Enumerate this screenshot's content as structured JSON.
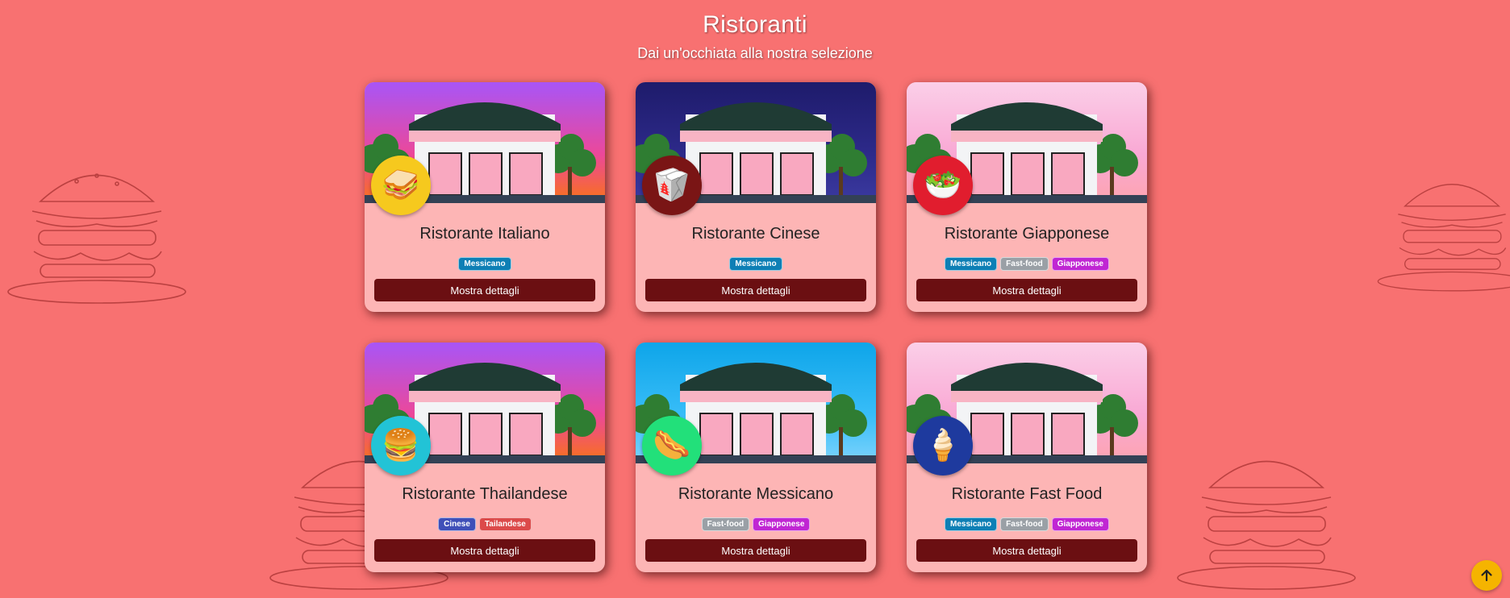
{
  "header": {
    "title": "Ristoranti",
    "subtitle": "Dai un'occhiata alla nostra selezione"
  },
  "tag_colors": {
    "Messicano": "#0e7fb5",
    "Fast-food": "#9aa0a6",
    "Giapponese": "#c026d3",
    "Cinese": "#3f4fb8",
    "Tailandese": "#dc4a4a"
  },
  "restaurants": [
    {
      "name": "Ristorante Italiano",
      "tags": [
        "Messicano"
      ],
      "button": "Mostra dettagli",
      "icon": "sandwich-icon",
      "glyph": "🥪",
      "avatar_color": "#f6c91e",
      "scene": "purple-dusk"
    },
    {
      "name": "Ristorante Cinese",
      "tags": [
        "Messicano"
      ],
      "button": "Mostra dettagli",
      "icon": "takeout-box-icon",
      "glyph": "🥡",
      "avatar_color": "#7a1515",
      "scene": "night"
    },
    {
      "name": "Ristorante Giapponese",
      "tags": [
        "Messicano",
        "Fast-food",
        "Giapponese"
      ],
      "button": "Mostra dettagli",
      "icon": "salad-icon",
      "glyph": "🥗",
      "avatar_color": "#e11d2e",
      "scene": "pink-sky"
    },
    {
      "name": "Ristorante Thailandese",
      "tags": [
        "Cinese",
        "Tailandese"
      ],
      "button": "Mostra dettagli",
      "icon": "hamburger-icon",
      "glyph": "🍔",
      "avatar_color": "#22c3d6",
      "scene": "purple-dusk"
    },
    {
      "name": "Ristorante Messicano",
      "tags": [
        "Fast-food",
        "Giapponese"
      ],
      "button": "Mostra dettagli",
      "icon": "hotdog-icon",
      "glyph": "🌭",
      "avatar_color": "#22e07a",
      "scene": "blue-day"
    },
    {
      "name": "Ristorante Fast Food",
      "tags": [
        "Messicano",
        "Fast-food",
        "Giapponese"
      ],
      "button": "Mostra dettagli",
      "icon": "ice-cream-icon",
      "glyph": "🍦",
      "avatar_color": "#1e3a9e",
      "scene": "pink-sky"
    }
  ],
  "scroll_top": {
    "icon": "arrow-up-icon",
    "color": "#f5b400"
  }
}
